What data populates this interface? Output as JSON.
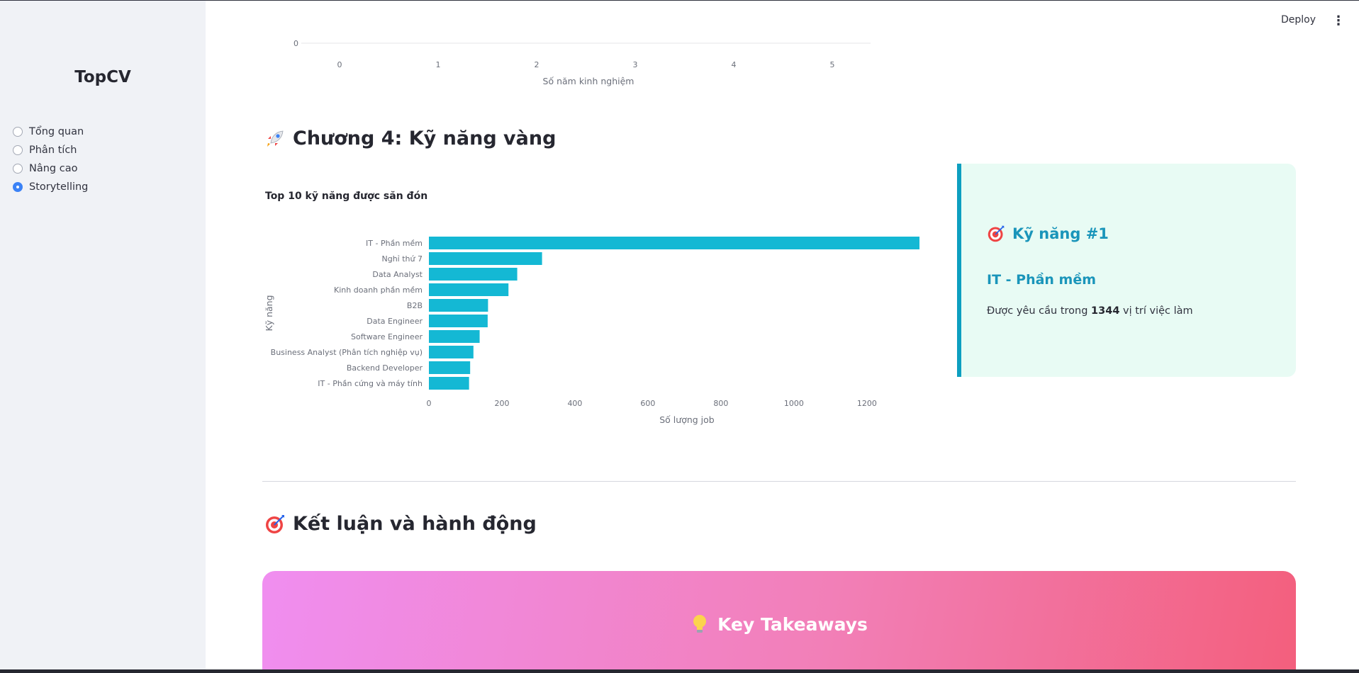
{
  "sidebar": {
    "brand": "TopCV",
    "items": [
      {
        "label": "Tổng quan",
        "selected": false
      },
      {
        "label": "Phân tích",
        "selected": false
      },
      {
        "label": "Nâng cao",
        "selected": false
      },
      {
        "label": "Storytelling",
        "selected": true
      }
    ]
  },
  "header": {
    "deploy_label": "Deploy",
    "menu_icon": "kebab-menu-icon"
  },
  "prev_chart": {
    "y_tick": "0",
    "x_ticks": [
      "0",
      "1",
      "2",
      "3",
      "4",
      "5"
    ],
    "xlabel": "Số năm kinh nghiệm"
  },
  "chapter4": {
    "title": "Chương 4: Kỹ năng vàng",
    "icon": "rocket-icon"
  },
  "chart_data": {
    "type": "bar",
    "orientation": "horizontal",
    "title": "Top 10 kỹ năng được săn đón",
    "categories": [
      "IT - Phần mềm",
      "Nghỉ thứ 7",
      "Data Analyst",
      "Kinh doanh phần mềm",
      "B2B",
      "Data Engineer",
      "Software Engineer",
      "Business Analyst (Phân tích nghiệp vụ)",
      "Backend Developer",
      "IT - Phần cứng và máy tính"
    ],
    "values": [
      1344,
      310,
      242,
      218,
      162,
      161,
      139,
      122,
      113,
      110
    ],
    "xlabel": "Số lượng job",
    "ylabel": "Kỹ năng",
    "x_ticks": [
      0,
      200,
      400,
      600,
      800,
      1000,
      1200
    ],
    "xlim": [
      0,
      1344
    ],
    "color": "#14b8d4",
    "grid": false
  },
  "callout": {
    "icon": "target-icon",
    "heading": "Kỹ năng #1",
    "skill": "IT - Phần mềm",
    "text_before": "Được yêu cầu trong ",
    "count": "1344",
    "text_after": " vị trí việc làm"
  },
  "conclusion": {
    "title": "Kết luận và hành động",
    "icon": "target-icon"
  },
  "takeaways": {
    "title": "Key Takeaways",
    "icon": "lightbulb-icon"
  },
  "colors": {
    "accent": "#0d9fc0",
    "bar": "#14b8d4",
    "callout_bg": "#e8fbf4",
    "sidebar_bg": "#f0f2f6"
  }
}
